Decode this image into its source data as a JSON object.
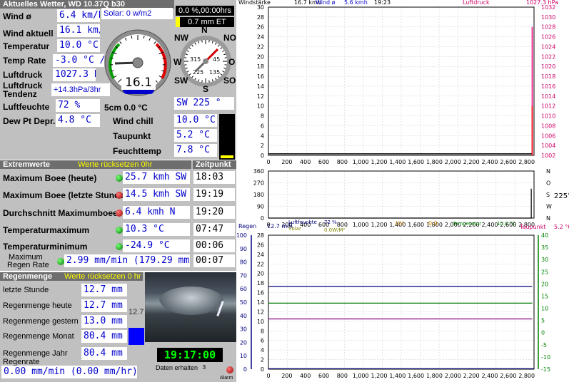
{
  "header": {
    "title": "Aktuelles Wetter, WD 10.37Q b30"
  },
  "current": {
    "wind_avg": {
      "label": "Wind ø",
      "value": "6.4 km/h"
    },
    "solar": "Solar: 0 w/m2",
    "sun_pct": "0.0 %,00:00hrs",
    "et": "0.7 mm ET",
    "wind_now": {
      "label": "Wind aktuell",
      "value": "16.1 km/"
    },
    "temperature": {
      "label": "Temperatur",
      "value": "10.0 °C"
    },
    "temp_rate": {
      "label": "Temp Rate",
      "value": "-3.0 °C /hr"
    },
    "pressure": {
      "label": "Luftdruck",
      "value": "1027.3 hPa"
    },
    "pressure_trend": {
      "label1": "Luftdruck",
      "label2": "Tendenz",
      "value": "+14.3hPa/3hr"
    },
    "humidity": {
      "label": "Luftfeuchte",
      "value": "72 %"
    },
    "soil": "5cm 0.0 °C",
    "wind_dir": "SW  225 °",
    "dew_pt_depr": {
      "label": "Dew Pt Depr.",
      "value": "4.8 °C"
    },
    "wind_chill": {
      "label": "Wind chill",
      "value": "10.0 °C"
    },
    "dew_point": {
      "label": "Taupunkt",
      "value": "5.2 °C"
    },
    "wet_bulb": {
      "label": "Feuchttemp",
      "value": "7.8 °C"
    }
  },
  "gauge": {
    "speed_readout": "16.1",
    "speed_fraction": 0.16,
    "compass": {
      "n": "N",
      "ne": "NO",
      "e": "O",
      "se": "SO",
      "s": "S",
      "sw": "SW",
      "w": "W",
      "nw": "NW",
      "deg_left": "315",
      "deg_right": "45",
      "deg_low_left": "225",
      "deg_low_right": "135"
    },
    "direction_deg": 225
  },
  "extremes": {
    "title": "Extremwerte",
    "reset_hint": "Werte rücksetzen 0hr",
    "time_title": "Zeitpunkt",
    "rows": [
      {
        "label": "Maximum Boee (heute)",
        "value": "25.7 kmh SW",
        "time": "18:03",
        "led": "green"
      },
      {
        "label": "Maximum Boee (letzte Stunde)",
        "value": "14.5 kmh  SW",
        "time": "19:19",
        "led": "red"
      },
      {
        "label": "Durchschnitt Maximumboee",
        "value": "6.4 kmh   N",
        "time": "19:20",
        "led": "red"
      },
      {
        "label": "Temperaturmaximum",
        "value": "10.3 °C",
        "time": "07:47",
        "led": "green"
      },
      {
        "label": "Temperaturminimum",
        "value": "-24.9 °C",
        "time": "00:06",
        "led": "green"
      }
    ],
    "max_rain_rate": {
      "label1": "Maximum",
      "label2": "Regen Rate",
      "value": "2.99 mm/min (179.29 mm/h",
      "time": "00:07"
    }
  },
  "rain": {
    "title": "Regenmenge",
    "reset_hint": "Werte rücksetzen 0 hr",
    "rows": [
      {
        "label": "letzte Stunde",
        "value": "12.7 mm"
      },
      {
        "label": "Regenmenge heute",
        "value": "12.7 mm"
      },
      {
        "label": "Regenmenge gestern",
        "value": "13.0 mm"
      },
      {
        "label": "Regenmenge Monat",
        "value": "80.4 mm"
      },
      {
        "label": "Regenmenge Jahr",
        "value": "80.4 mm"
      }
    ],
    "rate_label": "Regenrate",
    "rate_value": "0.00 mm/min (0.00 mm/hr)",
    "side_value": "12.7",
    "clock": "19:17:00",
    "data_received_label": "Daten erhalten",
    "data_received_count": "3",
    "alarm_label": "Alarm"
  },
  "colors": {
    "panel": "#c0c0c0",
    "value_text": "#0000cc",
    "title_bar": "#6e6e6e",
    "hint": "#ffff00"
  },
  "chart_data": [
    {
      "type": "line",
      "header": {
        "left": "Windstärke",
        "wind_val": "16.7 kmh",
        "wind_avg_lbl": "Wind ø",
        "wind_avg_val": "5.6 kmh",
        "time": "19:23",
        "right_lbl": "Luftdruck",
        "right_val": "1027.3 hPa"
      },
      "x_ticks": [
        "0",
        "200",
        "400",
        "600",
        "800",
        "1,000",
        "1,200",
        "1,400",
        "1,600",
        "1,800",
        "2,000",
        "2,200",
        "2,400",
        "2,600",
        "2,800"
      ],
      "y_ticks": [
        "0",
        "2",
        "4",
        "6",
        "8",
        "10",
        "12",
        "14",
        "16",
        "18",
        "20",
        "22",
        "24",
        "26",
        "28",
        "30"
      ],
      "ylim": [
        0,
        30
      ],
      "y2_ticks": [
        "1002",
        "1004",
        "1006",
        "1008",
        "1010",
        "1012",
        "1014",
        "1016",
        "1018",
        "1020",
        "1022",
        "1024",
        "1026",
        "1028",
        "1030",
        "1032"
      ],
      "y2lim": [
        1002,
        1032
      ],
      "xlim": [
        0,
        2880
      ],
      "series": [
        {
          "color": "#000000",
          "x": [
            0,
            2860
          ],
          "y": [
            0.3,
            0.3
          ]
        },
        {
          "color": "#ff0088",
          "x": [
            2860,
            2860
          ],
          "y": [
            0,
            26
          ]
        },
        {
          "color": "#ff0000",
          "x": [
            2860,
            2860
          ],
          "y": [
            0,
            10
          ]
        }
      ]
    },
    {
      "type": "line",
      "x_ticks": [
        "0",
        "200",
        "400",
        "600",
        "800",
        "1,000",
        "1,200",
        "1,400",
        "1,600",
        "1,800",
        "2,000",
        "2,200",
        "2,400",
        "2,600",
        "2,800"
      ],
      "y_ticks": [
        "0",
        "90",
        "180",
        "270",
        "360"
      ],
      "ylim": [
        0,
        360
      ],
      "dir_labels": [
        "N",
        "W",
        "S",
        "O",
        "N"
      ],
      "dir_readout": "225°",
      "series": [
        {
          "color": "#000000",
          "x": [
            0,
            2850,
            2850
          ],
          "y": [
            0,
            0,
            225
          ]
        }
      ]
    },
    {
      "type": "line",
      "header": {
        "rain_lbl": "Regen",
        "rain_val": "12.7 mm",
        "hum_lbl": "Luftfeuchte",
        "hum_val": "72 %",
        "solar_lbl": "Solar",
        "solar_val": "0.0W/M²",
        "uv_lbl": "UV",
        "uv_val": "0.0",
        "temp_lbl": "Temperatur",
        "temp_val": "10.0 °C",
        "dew_lbl": "Taupunkt",
        "dew_val": "5.2 °C"
      },
      "x_ticks": [
        "0",
        "200",
        "400",
        "600",
        "800",
        "1,000",
        "1,200",
        "1,400",
        "1,600",
        "1,800",
        "2,000",
        "2,200",
        "2,400",
        "2,600",
        "2,800"
      ],
      "y_ticks": [
        "0",
        "2",
        "4",
        "6",
        "8",
        "10",
        "12",
        "14",
        "16",
        "18",
        "20",
        "22",
        "24",
        "26",
        "28"
      ],
      "y_mid_ticks": [
        "0",
        "10",
        "20",
        "30",
        "40",
        "50",
        "60",
        "70",
        "80",
        "90",
        "100"
      ],
      "y2_ticks": [
        "-15",
        "-10",
        "-5",
        "0",
        "5",
        "10",
        "15",
        "20",
        "25",
        "30",
        "35",
        "40"
      ],
      "ylim": [
        0,
        28
      ],
      "series": [
        {
          "name": "Regen",
          "color": "#000080",
          "x": [
            0,
            2860
          ],
          "y": [
            17.3,
            17.3
          ]
        },
        {
          "name": "Temperatur",
          "color": "#008000",
          "x": [
            0,
            2860
          ],
          "y": [
            13.8,
            13.8
          ]
        },
        {
          "name": "Taupunkt",
          "color": "#800080",
          "x": [
            0,
            2860
          ],
          "y": [
            10.5,
            10.5
          ]
        },
        {
          "name": "Luftfeuchte",
          "color": "#000080",
          "x": [
            0,
            2880
          ],
          "y": [
            0.1,
            0.1
          ]
        }
      ]
    }
  ]
}
